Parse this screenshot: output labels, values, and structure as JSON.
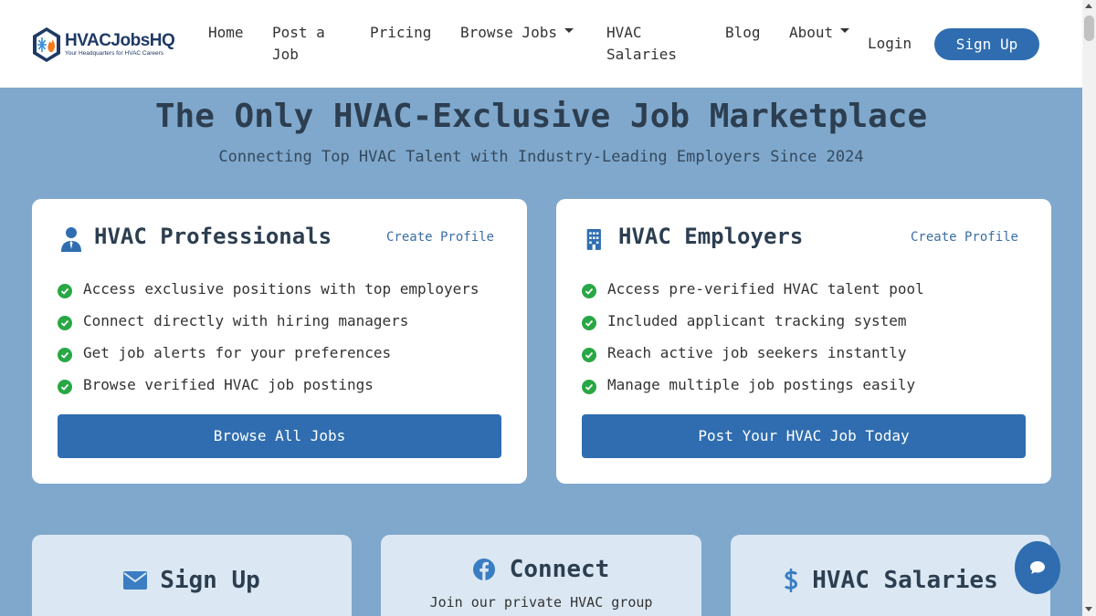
{
  "header": {
    "logo": {
      "name": "HVACJobsHQ",
      "tagline": "Your Headquarters for HVAC Careers",
      "icon": "snowflake-flame-hex-icon"
    },
    "nav": [
      {
        "label": "Home"
      },
      {
        "label": "Post a Job"
      },
      {
        "label": "Pricing"
      },
      {
        "label": "Browse Jobs",
        "dropdown": true
      },
      {
        "label": "HVAC Salaries"
      },
      {
        "label": "Blog"
      },
      {
        "label": "About",
        "dropdown": true
      }
    ],
    "login_label": "Login",
    "signup_label": "Sign Up"
  },
  "hero": {
    "title": "The Only HVAC-Exclusive Job Marketplace",
    "subtitle": "Connecting Top HVAC Talent with Industry-Leading Employers Since 2024"
  },
  "cards": [
    {
      "icon": "user-tie-icon",
      "title": "HVAC Professionals",
      "link": "Create Profile",
      "features": [
        "Access exclusive positions with top employers",
        "Connect directly with hiring managers",
        "Get job alerts for your preferences",
        "Browse verified HVAC job postings"
      ],
      "button": "Browse All Jobs"
    },
    {
      "icon": "building-icon",
      "title": "HVAC Employers",
      "link": "Create Profile",
      "features": [
        "Access pre-verified HVAC talent pool",
        "Included applicant tracking system",
        "Reach active job seekers instantly",
        "Manage multiple job postings easily"
      ],
      "button": "Post Your HVAC Job Today"
    }
  ],
  "bottom_cards": [
    {
      "icon": "envelope-icon",
      "title": "Sign Up",
      "text": ""
    },
    {
      "icon": "facebook-icon",
      "title": "Connect",
      "text": "Join our private HVAC group"
    },
    {
      "icon": "dollar-icon",
      "title": "HVAC Salaries",
      "text": ""
    }
  ],
  "chat": {
    "icon": "chat-bubble-icon"
  },
  "colors": {
    "primary": "#2f6db0",
    "background": "#7fa8cc",
    "check": "#28a745",
    "heading": "#2c3e50",
    "link": "#3a6ea5"
  }
}
